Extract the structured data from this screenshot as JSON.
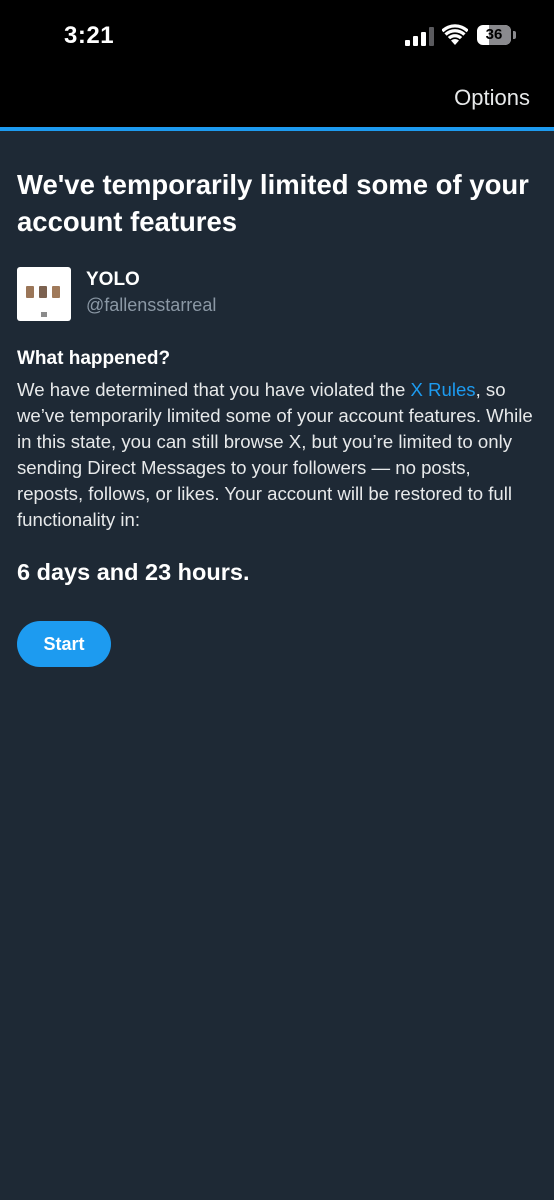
{
  "status_bar": {
    "time": "3:21",
    "battery_level": "36",
    "battery_fraction": 0.36,
    "signal_bars_active": 3,
    "signal_bars_total": 4
  },
  "header": {
    "options_label": "Options",
    "accent_color": "#1d9bf0"
  },
  "main": {
    "title": "We've temporarily limited some of your account features",
    "account": {
      "name": "YOLO",
      "handle": "@fallensstarreal"
    },
    "section_heading": "What happened?",
    "body_before_link": "We have determined that you have violated the ",
    "rules_link": "X Rules",
    "body_after_link": ", so we’ve temporarily limited some of your account features. While in this state, you can still browse X, but you’re limited to only sending Direct Messages to your followers — no posts, reposts, follows, or likes. Your account will be restored to full functionality in:",
    "time_remaining": "6 days and 23 hours.",
    "start_label": "Start"
  },
  "colors": {
    "background": "#1e2935",
    "status_bar_background": "#000000",
    "link": "#1d9bf0",
    "secondary_text": "#8b98a5"
  },
  "icons": [
    "cellular-signal-icon",
    "wifi-icon",
    "battery-icon"
  ]
}
